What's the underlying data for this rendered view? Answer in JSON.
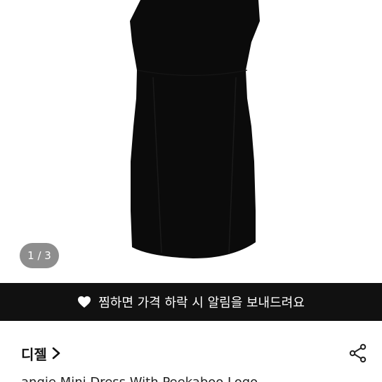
{
  "gallery": {
    "current_page": 1,
    "total_pages": 3,
    "page_label": "1 / 3"
  },
  "banner": {
    "icon": "heart-icon",
    "text": "찜하면 가격 하락 시 알림을 보내드려요"
  },
  "product": {
    "brand": "디젤",
    "title": "angie Mini Dress With Peekaboo Logo"
  },
  "icons": {
    "brand_chevron": "chevron-right-icon",
    "share": "share-icon"
  },
  "colors": {
    "banner_bg": "#111111",
    "indicator_bg": "#8e8e8e",
    "dress": "#0b0b0b"
  }
}
